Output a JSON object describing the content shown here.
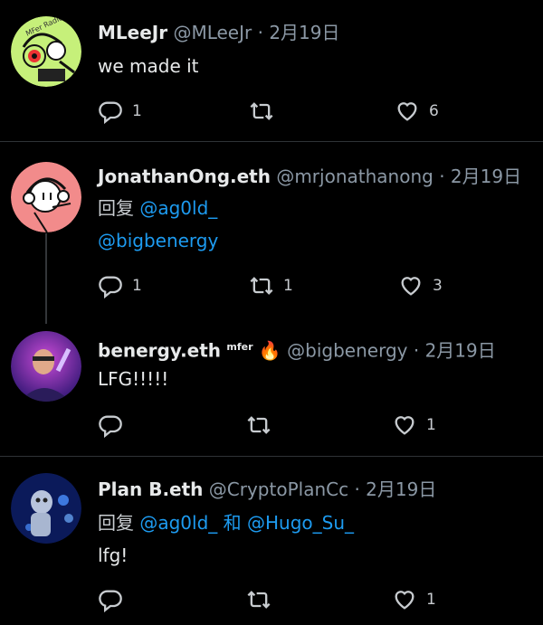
{
  "tweets": [
    {
      "name": "MLeeJr",
      "handle": "@MLeeJr",
      "dot": "·",
      "date": "2月19日",
      "reply_label": "",
      "text": "we made it",
      "replies": "1",
      "retweets": "",
      "likes": "6",
      "avatar_text": "MFer Radio"
    },
    {
      "name": "JonathanOng.eth",
      "handle": "@mrjonathanong",
      "dot": "·",
      "date": "2月19日",
      "reply_label": "回复",
      "mention": "@ag0ld_",
      "text": "@bigbenergy",
      "replies": "1",
      "retweets": "1",
      "likes": "3"
    },
    {
      "name": "benergy.eth",
      "badge": "mfer",
      "emoji": "🔥",
      "handle": "@bigbenergy",
      "dot": "·",
      "date": "2月19日",
      "text": "LFG!!!!!",
      "replies": "",
      "retweets": "",
      "likes": "1"
    },
    {
      "name": "Plan B.eth",
      "handle": "@CryptoPlanCc",
      "dot": "·",
      "date": "2月19日",
      "reply_label": "回复",
      "mention1": "@ag0ld_",
      "conj": "和",
      "mention2": "@Hugo_Su_",
      "text": "lfg!",
      "replies": "",
      "retweets": "",
      "likes": "1"
    }
  ],
  "colors": {
    "background": "#000000",
    "link": "#1d9bf0",
    "muted": "#8b98a5",
    "divider": "#2f3336"
  },
  "icons": [
    "reply-icon",
    "retweet-icon",
    "like-icon"
  ]
}
